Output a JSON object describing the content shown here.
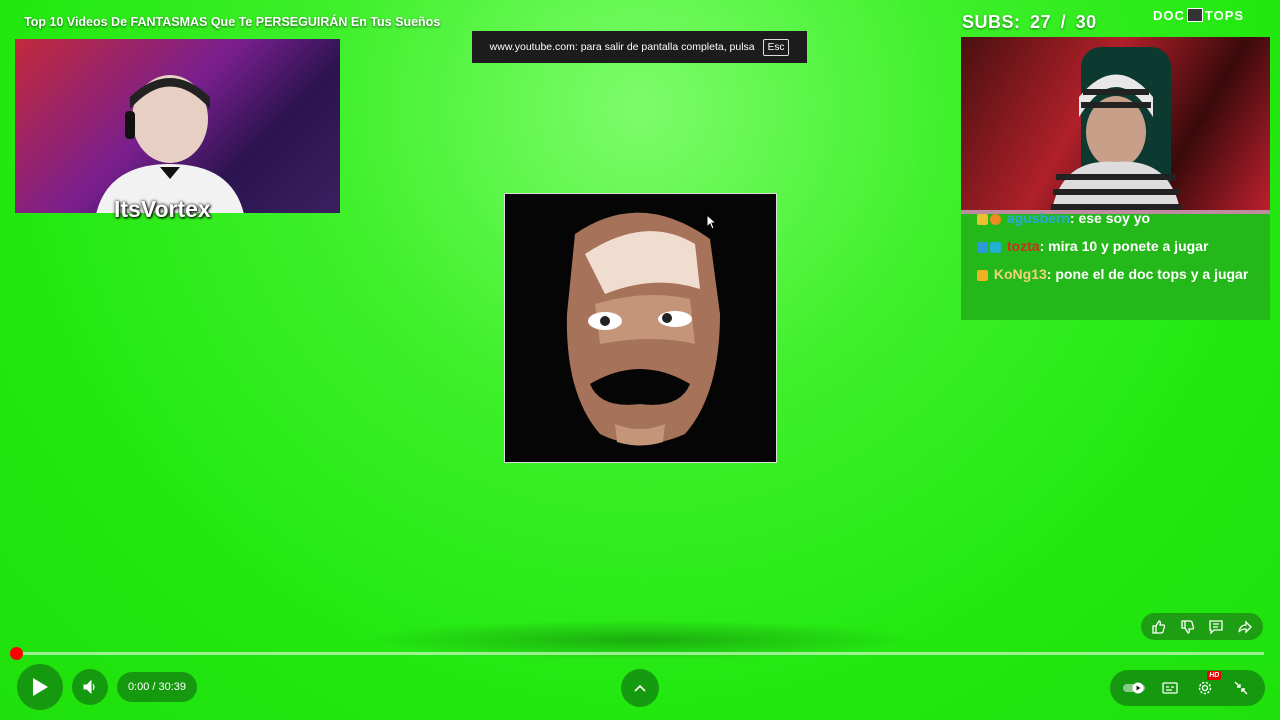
{
  "video": {
    "title": "Top 10 Videos De FANTASMAS Que Te PERSEGUIRÁN En Tus Sueños"
  },
  "fullscreen_notice": {
    "text": "www.youtube.com: para salir de pantalla completa, pulsa",
    "key": "Esc"
  },
  "overlay": {
    "streamer_name": "ItsVortex",
    "subs_label": "SUBS:",
    "subs_current": "27",
    "subs_goal": "/ 30",
    "logo_left": "DOC",
    "logo_right": "TOPS"
  },
  "chat": {
    "messages": [
      {
        "user": "agusbern",
        "sep": ":",
        "text": "ese soy yo"
      },
      {
        "user": "tozta",
        "sep": ":",
        "text": "mira 10 y ponete a jugar"
      },
      {
        "user": "KoNg13",
        "sep": ":",
        "text": "pone el de doc tops y a jugar"
      }
    ]
  },
  "player": {
    "time": "0:00 / 30:39",
    "progress": 0.0,
    "hd_badge": "HD"
  },
  "icons": {
    "like": "thumbs-up-icon",
    "dislike": "thumbs-down-icon",
    "comment": "comment-icon",
    "share": "share-icon",
    "play": "play-icon",
    "volume": "volume-icon",
    "expand": "chevron-up-icon",
    "autoplay": "autoplay-toggle-icon",
    "subtitles": "subtitles-icon",
    "settings": "gear-icon",
    "exit_fullscreen": "exit-fullscreen-icon"
  },
  "colors": {
    "progress": "#ff0000",
    "background": "#22e80f",
    "user_agusbern": "#2ba8e0",
    "user_tozta": "#d42a20",
    "user_kong13": "#f3d27a"
  }
}
